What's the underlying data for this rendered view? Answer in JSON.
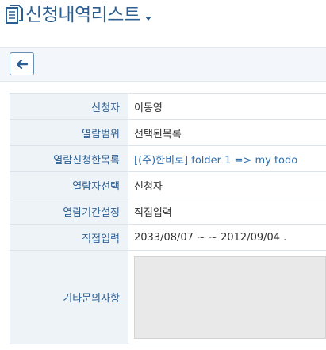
{
  "header": {
    "title": "신청내역리스트"
  },
  "toolbar": {
    "back_icon": "arrow-left"
  },
  "form": {
    "applicant": {
      "label": "신청자",
      "value": "이동영"
    },
    "scope": {
      "label": "열람범위",
      "value": "선택된목록"
    },
    "request_list": {
      "label": "열람신청한목록",
      "value": "[(주)한비로] folder 1 => my todo"
    },
    "viewer_select": {
      "label": "열람자선택",
      "value": "신청자"
    },
    "period_setting": {
      "label": "열람기간설정",
      "value": "직접입력"
    },
    "direct_input": {
      "label": "직접입력",
      "value": "2033/08/07 ~ ~ 2012/09/04 ."
    },
    "other_inquiry": {
      "label": "기타문의사항",
      "value": ""
    }
  },
  "colors": {
    "accent": "#2c5e91",
    "label_bg": "#eef3f8",
    "link": "#2c6eb0"
  }
}
